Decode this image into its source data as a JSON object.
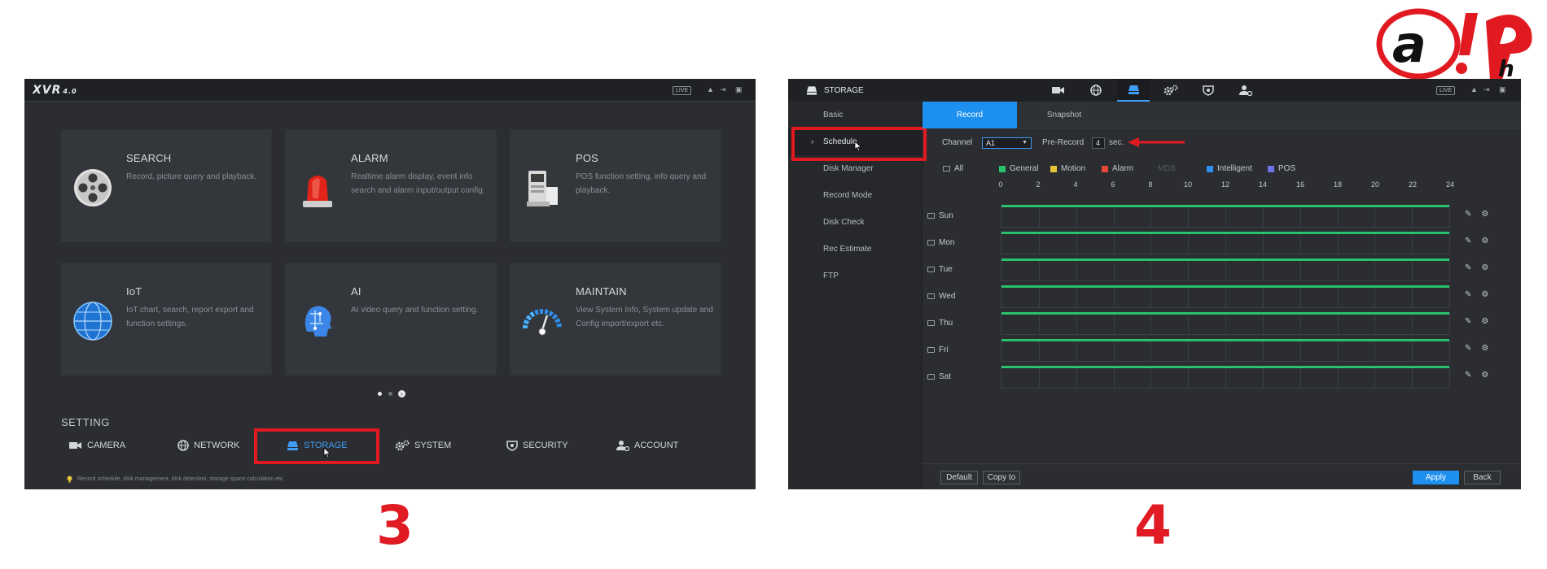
{
  "panel3": {
    "brand": "XVR",
    "brand_version": "4.0",
    "live_badge": "LIVE",
    "tiles": [
      {
        "title": "SEARCH",
        "desc": "Record, picture query and playback.",
        "icon": "film-reel-icon"
      },
      {
        "title": "ALARM",
        "desc": "Realtime alarm display, event info search and alarm input/output config.",
        "icon": "siren-icon"
      },
      {
        "title": "POS",
        "desc": "POS function setting, info query and playback.",
        "icon": "pos-terminal-icon"
      },
      {
        "title": "IoT",
        "desc": "IoT chart, search, report export and function settings.",
        "icon": "globe-icon"
      },
      {
        "title": "AI",
        "desc": "AI video query and function setting.",
        "icon": "ai-head-icon"
      },
      {
        "title": "MAINTAIN",
        "desc": "View System Info, System update and Config import/export etc.",
        "icon": "gauge-icon"
      }
    ],
    "setting_title": "SETTING",
    "settings": [
      {
        "label": "CAMERA",
        "icon": "camera-icon"
      },
      {
        "label": "NETWORK",
        "icon": "network-globe-icon"
      },
      {
        "label": "STORAGE",
        "icon": "storage-icon"
      },
      {
        "label": "SYSTEM",
        "icon": "gears-icon"
      },
      {
        "label": "SECURITY",
        "icon": "shield-icon"
      },
      {
        "label": "ACCOUNT",
        "icon": "account-icon"
      }
    ],
    "hint": "Record schedule, disk management, disk detection, storage space calculation etc.",
    "page_dots": 3,
    "active_dot": 1
  },
  "panel4": {
    "title": "STORAGE",
    "live_badge": "LIVE",
    "sidebar": [
      "Basic",
      "Schedule",
      "Disk Manager",
      "Record Mode",
      "Disk Check",
      "Rec Estimate",
      "FTP"
    ],
    "active_sidebar": "Schedule",
    "tabs": [
      "Record",
      "Snapshot"
    ],
    "active_tab": "Record",
    "channel_label": "Channel",
    "channel_value": "A1",
    "prerecord_label": "Pre-Record",
    "prerecord_value": "4",
    "prerecord_unit": "sec.",
    "all_label": "All",
    "legend": [
      {
        "label": "General",
        "color": "#27c26b"
      },
      {
        "label": "Motion",
        "color": "#e6c335"
      },
      {
        "label": "Alarm",
        "color": "#e5483a"
      },
      {
        "label": "MD&",
        "color": "#4a4d52"
      },
      {
        "label": "Intelligent",
        "color": "#2f8ff0"
      },
      {
        "label": "POS",
        "color": "#6f72e8"
      }
    ],
    "hours": [
      "0",
      "2",
      "4",
      "6",
      "8",
      "10",
      "12",
      "14",
      "16",
      "18",
      "20",
      "22",
      "24"
    ],
    "days": [
      "Sun",
      "Mon",
      "Tue",
      "Wed",
      "Thu",
      "Fri",
      "Sat"
    ],
    "schedule_fill": "full-day General on all days",
    "buttons": {
      "default": "Default",
      "copy_to": "Copy to",
      "apply": "Apply",
      "back": "Back"
    }
  },
  "labels": {
    "step3": "3",
    "step4": "4"
  },
  "colors": {
    "accent": "#1e90f0",
    "highlight": "#e11a22",
    "schedule": "#27c26b"
  }
}
